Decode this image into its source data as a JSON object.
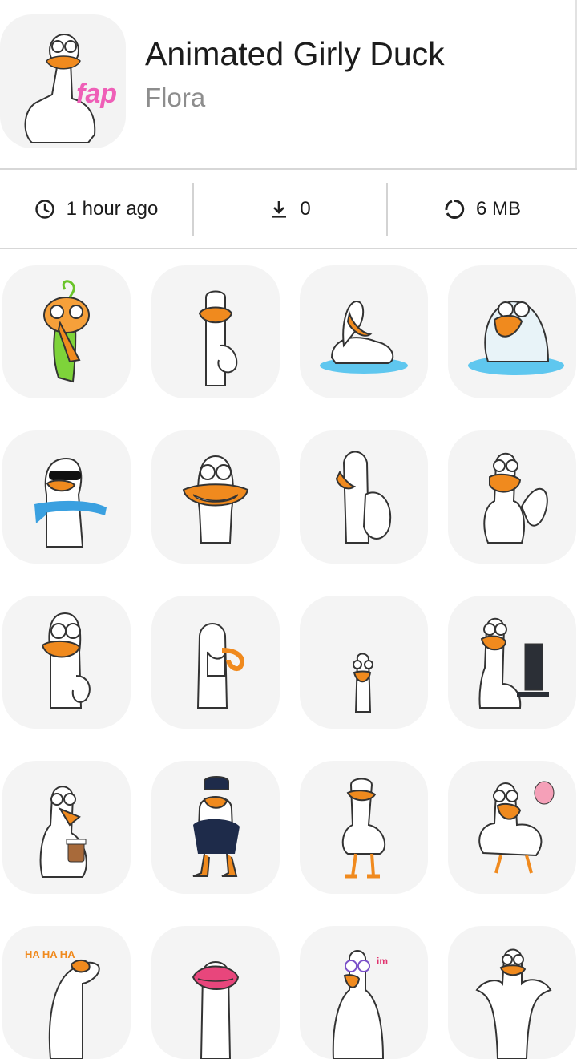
{
  "pack": {
    "title": "Animated Girly Duck",
    "author": "Flora",
    "icon_caption": "fap"
  },
  "stats": {
    "time": {
      "icon": "clock-icon",
      "label": "1 hour ago"
    },
    "downloads": {
      "icon": "download-icon",
      "label": "0"
    },
    "size": {
      "icon": "storage-ring-icon",
      "label": "6 MB"
    }
  },
  "stickers": [
    {
      "name": "sticker-angry-green-duck",
      "text": ""
    },
    {
      "name": "sticker-shush-duck",
      "text": ""
    },
    {
      "name": "sticker-swimming-duck",
      "text": ""
    },
    {
      "name": "sticker-crying-duck",
      "text": ""
    },
    {
      "name": "sticker-cool-scarf-duck",
      "text": ""
    },
    {
      "name": "sticker-grinning-duck",
      "text": ""
    },
    {
      "name": "sticker-shy-duck",
      "text": ""
    },
    {
      "name": "sticker-waving-duck",
      "text": ""
    },
    {
      "name": "sticker-thumbs-up-duck",
      "text": ""
    },
    {
      "name": "sticker-facepalm-duck",
      "text": ""
    },
    {
      "name": "sticker-skinny-duck",
      "text": ""
    },
    {
      "name": "sticker-computer-duck",
      "text": ""
    },
    {
      "name": "sticker-coffee-duck",
      "text": ""
    },
    {
      "name": "sticker-police-duck",
      "text": ""
    },
    {
      "name": "sticker-standing-duck",
      "text": ""
    },
    {
      "name": "sticker-dancing-duck",
      "text": ""
    },
    {
      "name": "sticker-laughing-duck",
      "text": "HA HA HA"
    },
    {
      "name": "sticker-kiss-lips-duck",
      "text": ""
    },
    {
      "name": "sticker-lipstick-duck",
      "text": "im"
    },
    {
      "name": "sticker-shrugging-duck",
      "text": ""
    }
  ]
}
